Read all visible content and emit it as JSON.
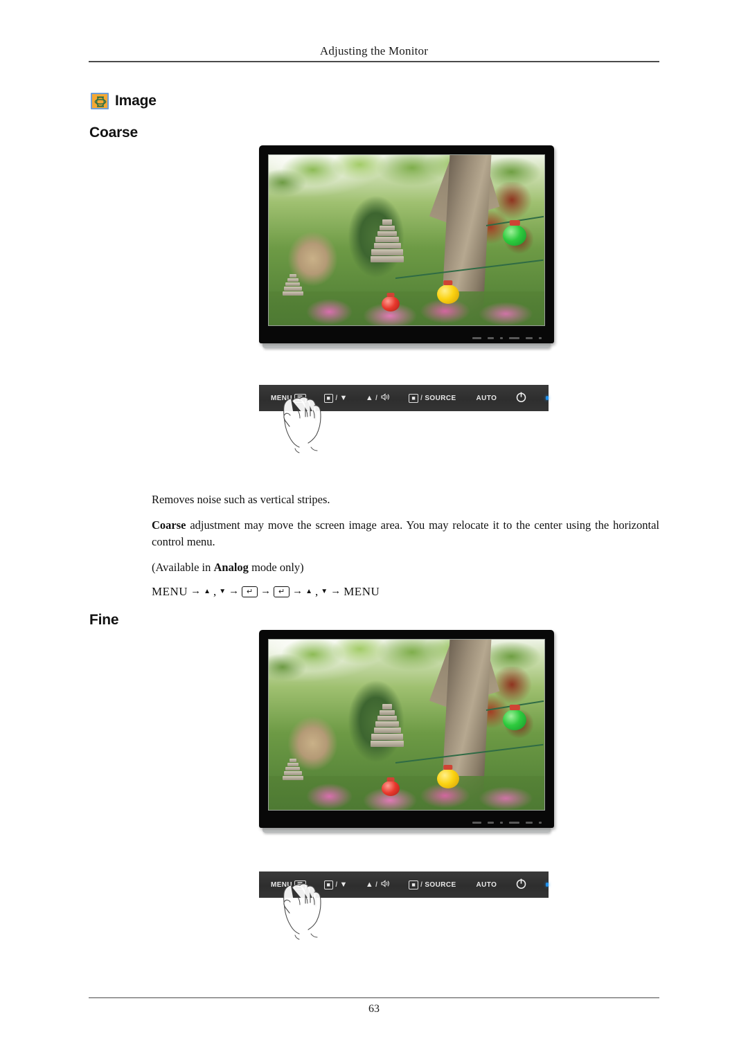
{
  "header": {
    "running_title": "Adjusting the Monitor"
  },
  "section": {
    "icon": "image-settings-icon",
    "title": "Image",
    "icon_colors": {
      "fill": "#f5a833",
      "border": "#6f9fd8"
    }
  },
  "subsections": [
    {
      "id": "coarse",
      "heading": "Coarse",
      "monitor_caption": "monitor displaying garden photograph with stone pagodas and paper lanterns",
      "paragraphs": [
        {
          "id": "intro",
          "segments": [
            {
              "text": "Removes noise such as vertical stripes.",
              "bold": false
            }
          ]
        },
        {
          "id": "detail",
          "segments": [
            {
              "text": "Coarse",
              "bold": true
            },
            {
              "text": " adjustment may move the screen image area. You may relocate it to the center using the horizontal control menu.",
              "bold": false
            }
          ]
        },
        {
          "id": "availability",
          "segments": [
            {
              "text": "(Available in ",
              "bold": false
            },
            {
              "text": "Analog",
              "bold": true
            },
            {
              "text": " mode only)",
              "bold": false
            }
          ]
        }
      ],
      "nav_path": {
        "tokens": [
          "MENU",
          "→",
          "▲",
          ",",
          "▼",
          "→",
          "ENTER",
          "→",
          "ENTER",
          "→",
          "▲",
          ",",
          "▼",
          "→",
          "MENU"
        ],
        "enter_glyph": "↵",
        "display": "MENU → ▲ , ▼ → ↵ → ↵ → ▲ , ▼ → MENU"
      }
    },
    {
      "id": "fine",
      "heading": "Fine",
      "monitor_caption": "monitor displaying garden photograph with stone pagodas and paper lanterns"
    }
  ],
  "control_panel": {
    "background": "#333333",
    "led_color": "#1f90ec",
    "buttons": [
      {
        "id": "menu",
        "label": "MENU",
        "glyph": "",
        "name": "menu-button"
      },
      {
        "id": "minus",
        "label": "",
        "glyph": "−",
        "suffix": "/",
        "arrow": "▼",
        "name": "minus-down-button"
      },
      {
        "id": "up",
        "label": "",
        "glyph": "▲",
        "suffix": "/",
        "arrow": "",
        "name": "up-volume-button"
      },
      {
        "id": "source",
        "label": "SOURCE",
        "glyph": "−",
        "suffix": "/",
        "name": "enter-source-button"
      },
      {
        "id": "auto",
        "label": "AUTO",
        "glyph": "",
        "name": "auto-button"
      },
      {
        "id": "power",
        "label": "",
        "glyph": "⏻",
        "name": "power-button"
      },
      {
        "id": "led",
        "label": "",
        "glyph": "",
        "name": "power-led-indicator"
      }
    ],
    "labels": {
      "menu": "MENU",
      "source": "SOURCE",
      "auto": "AUTO",
      "slash": "/"
    },
    "hand_overlay": "hand pressing the MENU button"
  },
  "footer": {
    "page_number": "63"
  }
}
